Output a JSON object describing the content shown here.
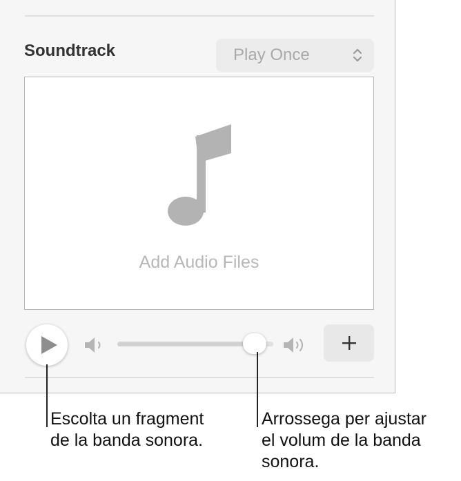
{
  "soundtrack": {
    "section_title": "Soundtrack",
    "playback_mode": "Play Once",
    "dropzone_label": "Add Audio Files",
    "volume_fraction": 0.88
  },
  "icons": {
    "popup": "up-down-chevrons-icon",
    "note": "music-note-icon",
    "play": "play-icon",
    "volume_low": "speaker-low-icon",
    "volume_high": "speaker-high-icon",
    "add": "plus-icon"
  },
  "callouts": {
    "play": "Escolta un fragment\nde la banda sonora.",
    "slider": "Arrossega per ajustar\nel volum de la banda\nsonora."
  },
  "colors": {
    "panel_bg": "#f7f6f6",
    "icon_gray": "#b3b3b3",
    "button_gray": "#e8e8e8"
  }
}
